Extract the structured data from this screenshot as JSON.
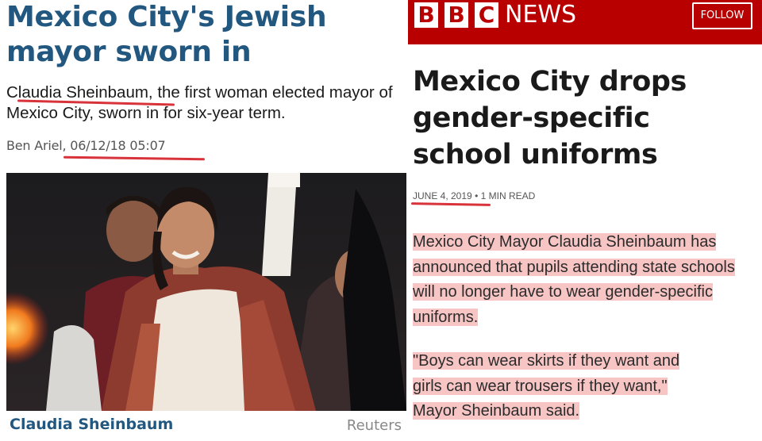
{
  "left_article": {
    "headline": "Mexico City's Jewish mayor sworn in",
    "subheadline": "Claudia Sheinbaum, the first woman elected mayor of Mexico City, sworn in for six-year term.",
    "byline": "Ben Ariel, 06/12/18 05:07",
    "photo_caption": "Claudia Sheinbaum",
    "photo_credit": "Reuters"
  },
  "bbc": {
    "logo_letters": [
      "B",
      "B",
      "C"
    ],
    "brand_suffix": "NEWS",
    "follow_label": "FOLLOW",
    "headline": "Mexico City drops gender-specific school uniforms",
    "date": "JUNE 4, 2019",
    "separator": "•",
    "read_time": "1 MIN READ",
    "paragraph1": "Mexico City Mayor Claudia Sheinbaum has announced that pupils attending state schools will no longer have to wear gender-specific uniforms.",
    "quote_lines": [
      "\"Boys can wear skirts if they want and",
      "girls can wear trousers if they want,\"",
      "Mayor Sheinbaum said."
    ]
  },
  "colors": {
    "bbc_red": "#b80000",
    "headline_blue": "#22577f",
    "annotation_red": "#d8333a",
    "highlight_pink": "#f29696"
  }
}
